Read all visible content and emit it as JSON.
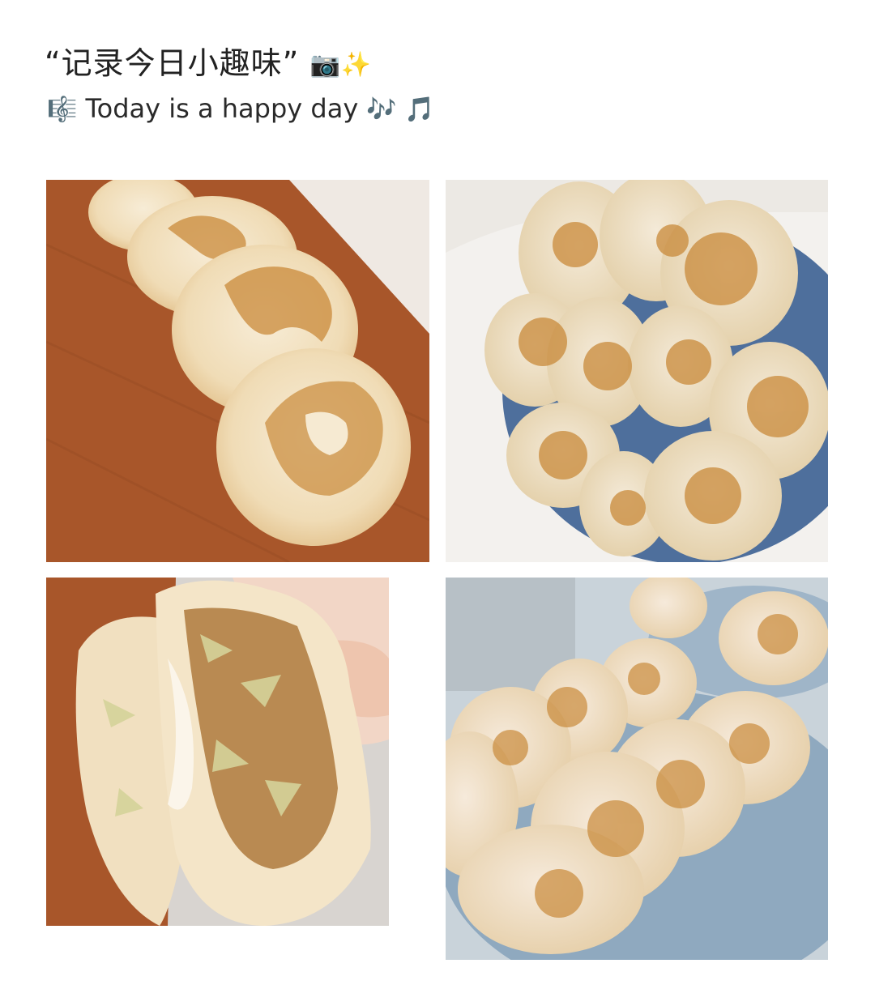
{
  "header": {
    "title": "“记录今日小趣味”",
    "title_emojis": "📷✨",
    "subtitle_icon": "🎼",
    "subtitle": "Today is a happy day",
    "subtitle_emojis": "🎶 🎵"
  },
  "photos": [
    {
      "subject": "pan-fried buns on wooden cutting board"
    },
    {
      "subject": "pan-fried buns piled on blue plate"
    },
    {
      "subject": "bun split open showing cabbage and meat filling"
    },
    {
      "subject": "pan-fried buns on light blue plates"
    }
  ],
  "colors": {
    "wood": "#a8562a",
    "bun": "#f3e2c3",
    "browned": "#c98a3a",
    "plate_blue": "#5f7fa8",
    "plate_light": "#9fb5c8"
  }
}
